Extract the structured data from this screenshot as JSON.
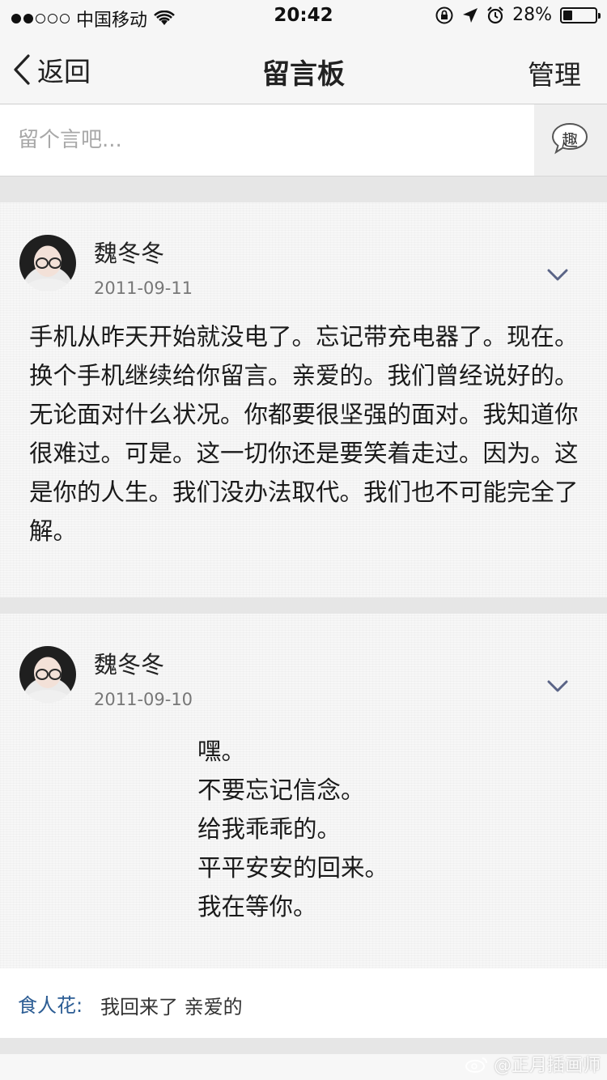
{
  "status_bar": {
    "carrier": "中国移动",
    "time": "20:42",
    "battery_percent": "28%",
    "battery_level": 0.28
  },
  "nav": {
    "back_label": "返回",
    "title": "留言板",
    "manage_label": "管理"
  },
  "composer": {
    "placeholder": "留个言吧...",
    "fun_button_label": "趣"
  },
  "messages": [
    {
      "author": "魏冬冬",
      "date": "2011-09-11",
      "text": "手机从昨天开始就没电了。忘记带充电器了。现在。换个手机继续给你留言。亲爱的。我们曾经说好的。无论面对什么状况。你都要很坚强的面对。我知道你很难过。可是。这一切你还是要笑着走过。因为。这是你的人生。我们没办法取代。我们也不可能完全了解。"
    },
    {
      "author": "魏冬冬",
      "date": "2011-09-10",
      "lines": [
        "嘿。",
        "不要忘记信念。",
        "给我乖乖的。",
        "平平安安的回来。",
        "我在等你。"
      ],
      "reply": {
        "name": "食人花",
        "separator": ":",
        "text": "我回来了 亲爱的"
      }
    }
  ],
  "watermark": "@正月插画师",
  "colors": {
    "reply_name": "#2c5d94",
    "page_background": "#e6e6e6",
    "card_background": "#f7f7f7"
  }
}
